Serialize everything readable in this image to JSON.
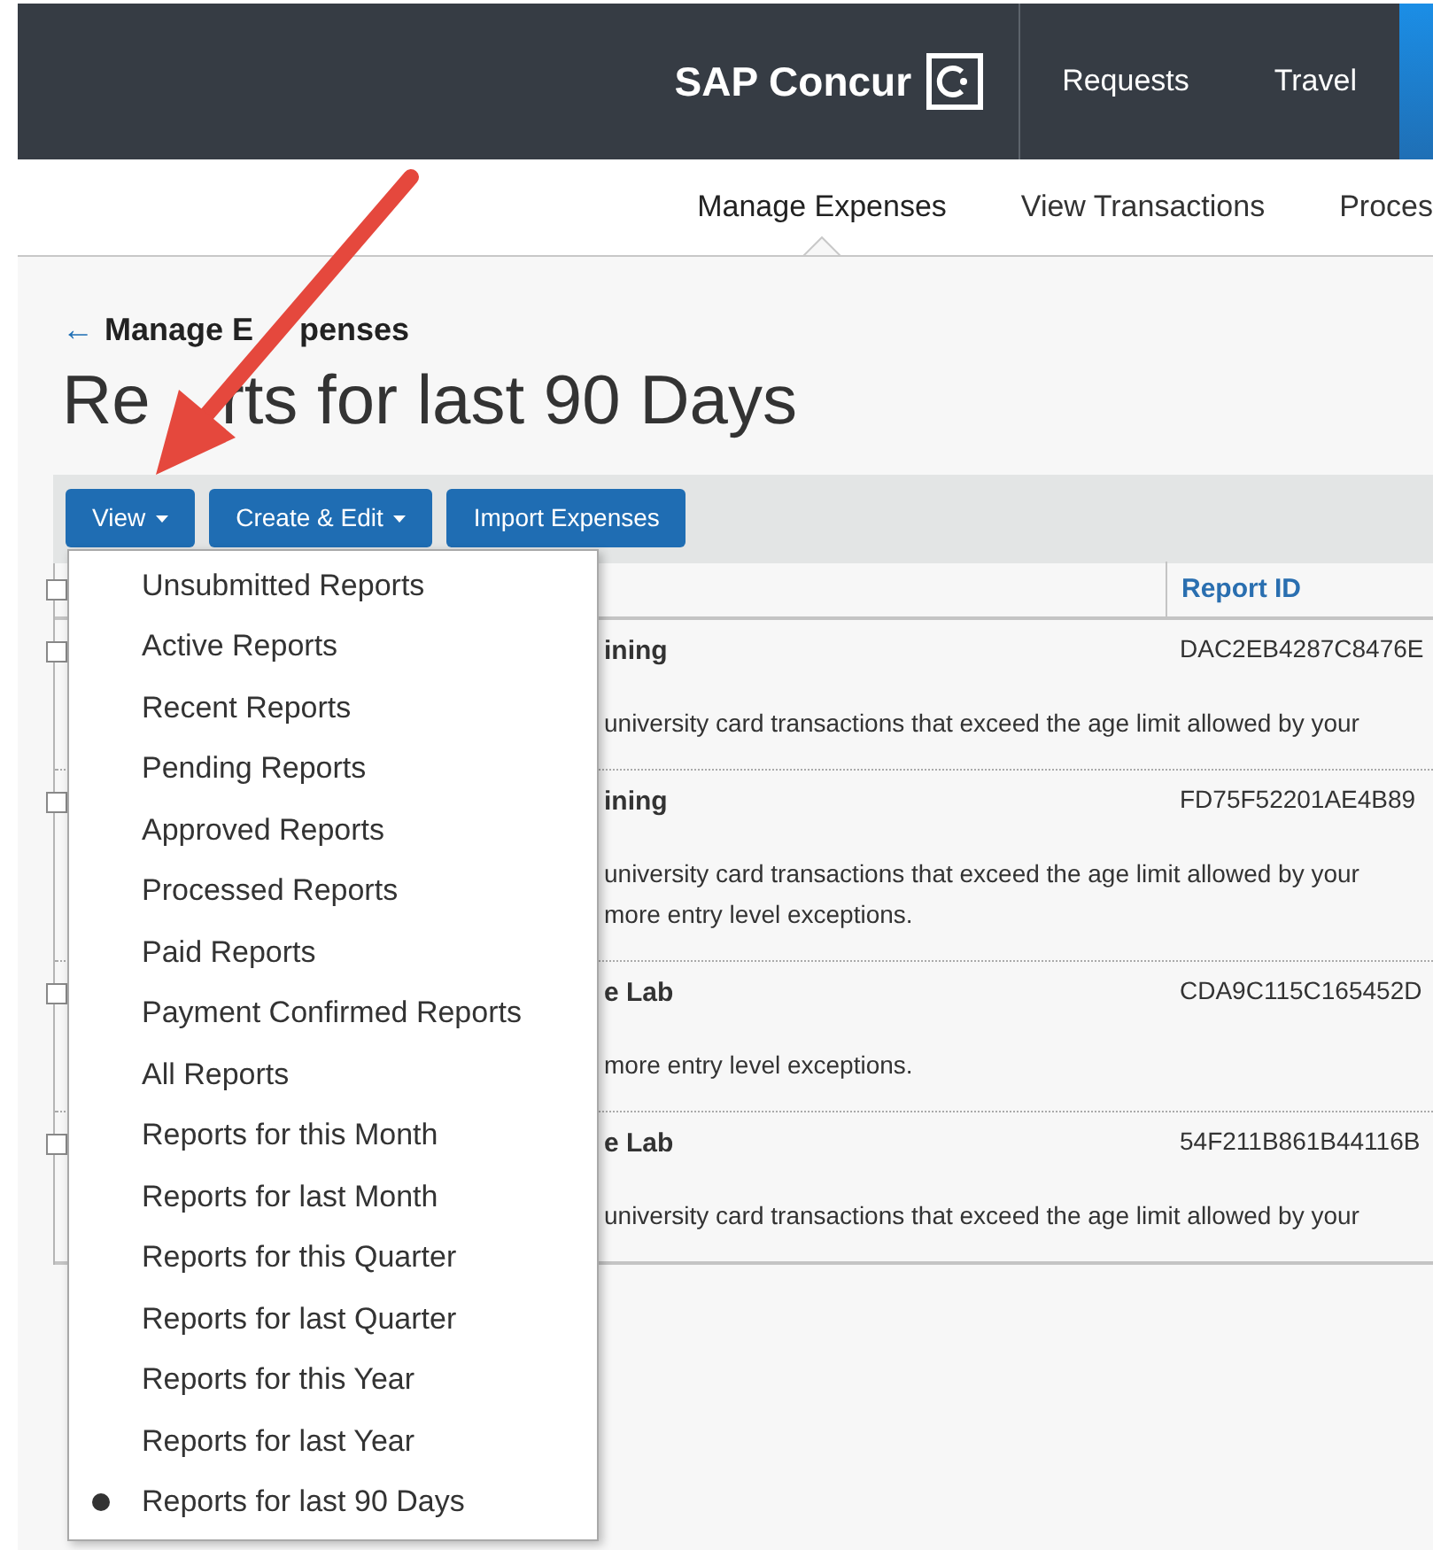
{
  "header": {
    "logo": "SAP Concur",
    "nav": [
      {
        "label": "Requests",
        "selected": false
      },
      {
        "label": "Travel",
        "selected": false
      }
    ]
  },
  "subnav": [
    {
      "label": "Manage Expenses",
      "selected": true
    },
    {
      "label": "View Transactions",
      "selected": false
    },
    {
      "label": "Proces",
      "selected": false
    }
  ],
  "back_link": {
    "arrow": "←",
    "label_parts": [
      "Manage E",
      "penses"
    ]
  },
  "title_parts": [
    "Re",
    "rts for last 90 Days"
  ],
  "toolbar": [
    {
      "label": "View",
      "dropdown": true
    },
    {
      "label": "Create & Edit",
      "dropdown": true
    },
    {
      "label": "Import Expenses",
      "dropdown": false
    }
  ],
  "table": {
    "select_all": {
      "checked": false
    },
    "columns": [
      {
        "label": "Report ID"
      }
    ],
    "rows": [
      {
        "checked": false,
        "name": "ining",
        "report_id": "DAC2EB4287C8476E",
        "exceptions": [
          "university card transactions that exceed the age limit allowed by your"
        ]
      },
      {
        "checked": false,
        "name": "ining",
        "report_id": "FD75F52201AE4B89",
        "exceptions": [
          "university card transactions that exceed the age limit allowed by your",
          "more entry level exceptions."
        ]
      },
      {
        "checked": false,
        "name": "e Lab",
        "report_id": "CDA9C115C165452D",
        "exceptions": [
          "more entry level exceptions."
        ]
      },
      {
        "checked": false,
        "name": "e Lab",
        "report_id": "54F211B861B44116B",
        "exceptions": [
          "university card transactions that exceed the age limit allowed by your"
        ]
      }
    ]
  },
  "view_menu": {
    "items": [
      {
        "label": "Unsubmitted Reports",
        "selected": false
      },
      {
        "label": "Active Reports",
        "selected": false
      },
      {
        "label": "Recent Reports",
        "selected": false
      },
      {
        "label": "Pending Reports",
        "selected": false
      },
      {
        "label": "Approved Reports",
        "selected": false
      },
      {
        "label": "Processed Reports",
        "selected": false
      },
      {
        "label": "Paid Reports",
        "selected": false
      },
      {
        "label": "Payment Confirmed Reports",
        "selected": false
      },
      {
        "label": "All Reports",
        "selected": false
      },
      {
        "label": "Reports for this Month",
        "selected": false
      },
      {
        "label": "Reports for last Month",
        "selected": false
      },
      {
        "label": "Reports for this Quarter",
        "selected": false
      },
      {
        "label": "Reports for last Quarter",
        "selected": false
      },
      {
        "label": "Reports for this Year",
        "selected": false
      },
      {
        "label": "Reports for last Year",
        "selected": false
      },
      {
        "label": "Reports for last 90 Days",
        "selected": true
      }
    ]
  },
  "annotation": {
    "kind": "arrow"
  }
}
